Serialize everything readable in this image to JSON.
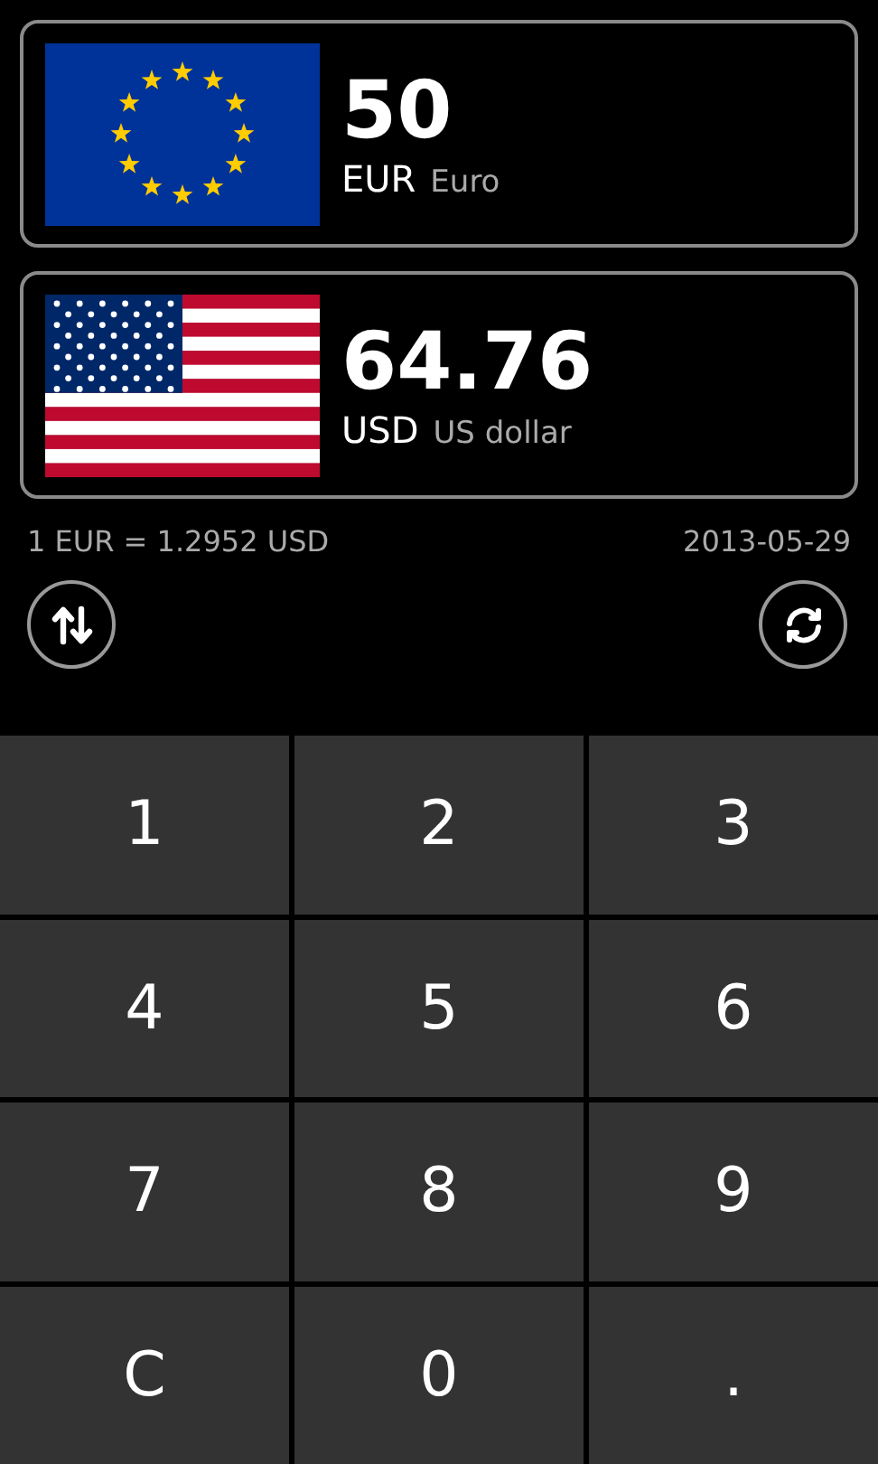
{
  "currencies": [
    {
      "kind": "eu",
      "amount": "50",
      "code": "EUR",
      "name": "Euro"
    },
    {
      "kind": "us",
      "amount": "64.76",
      "code": "USD",
      "name": "US dollar"
    }
  ],
  "rate": "1 EUR = 1.2952 USD",
  "date": "2013-05-29",
  "keys": [
    "1",
    "2",
    "3",
    "4",
    "5",
    "6",
    "7",
    "8",
    "9",
    "C",
    "0",
    "."
  ]
}
